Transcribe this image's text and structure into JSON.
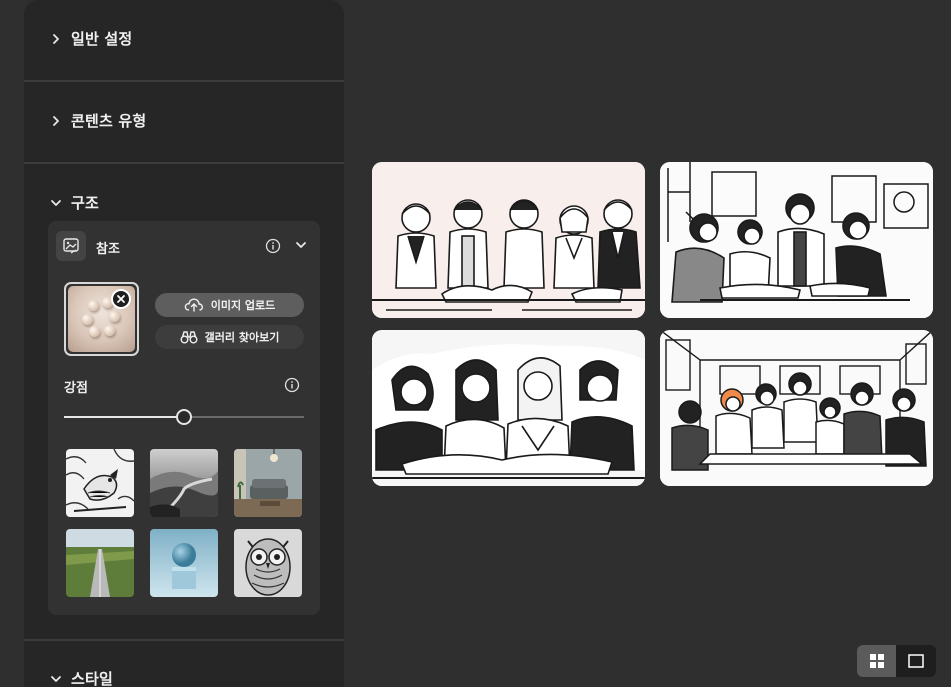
{
  "panel": {
    "sections": [
      {
        "title": "일반 설정",
        "expanded": false
      },
      {
        "title": "콘텐츠 유형",
        "expanded": false
      },
      {
        "title": "구조",
        "expanded": true
      },
      {
        "title": "스타일",
        "expanded": true
      }
    ]
  },
  "reference": {
    "title": "참조",
    "upload_label": "이미지 업로드",
    "gallery_label": "갤러리 찾아보기",
    "strength_label": "강점",
    "strength_value": 0.5,
    "thumbnails": [
      {
        "name": "bird-sketch-thumb"
      },
      {
        "name": "misty-river-thumb"
      },
      {
        "name": "living-room-thumb"
      },
      {
        "name": "green-field-road-thumb"
      },
      {
        "name": "sphere-pedestal-thumb"
      },
      {
        "name": "owl-pattern-thumb"
      }
    ]
  },
  "results": [
    {
      "name": "result-image-1"
    },
    {
      "name": "result-image-2"
    },
    {
      "name": "result-image-3"
    },
    {
      "name": "result-image-4"
    }
  ],
  "view_toggle": {
    "active": "grid"
  },
  "colors": {
    "panel": "#262626",
    "background": "#2f2f2f",
    "card": "#323232",
    "accent_pill": "#5e5e5e"
  }
}
